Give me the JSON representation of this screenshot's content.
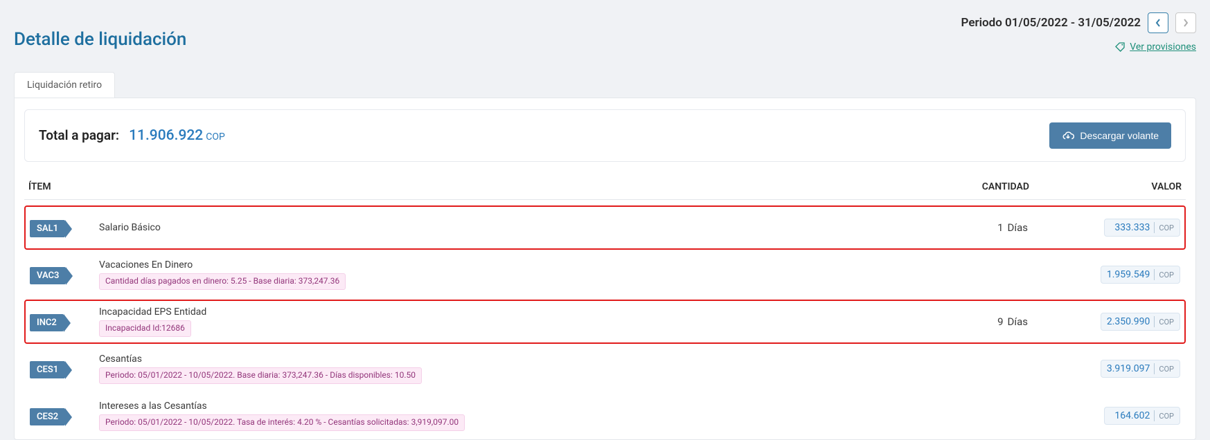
{
  "header": {
    "title": "Detalle de liquidación",
    "period_text": "Periodo 01/05/2022 - 31/05/2022",
    "provisions_link": "Ver provisiones"
  },
  "tabs": {
    "items": [
      {
        "label": "Liquidación retiro"
      }
    ]
  },
  "summary": {
    "total_label": "Total a pagar:",
    "total_value": "11.906.922",
    "total_currency": "COP",
    "download_label": "Descargar volante"
  },
  "table": {
    "columns": {
      "item": "ÍTEM",
      "qty": "CANTIDAD",
      "value": "VALOR"
    },
    "rows": [
      {
        "code": "SAL1",
        "title": "Salario Básico",
        "sub": "",
        "qty_num": "1",
        "qty_unit": "Días",
        "value": "333.333",
        "currency": "COP",
        "highlight": true
      },
      {
        "code": "VAC3",
        "title": "Vacaciones En Dinero",
        "sub": "Cantidad días pagados en dinero: 5.25 - Base diaria: 373,247.36",
        "qty_num": "",
        "qty_unit": "",
        "value": "1.959.549",
        "currency": "COP",
        "highlight": false
      },
      {
        "code": "INC2",
        "title": "Incapacidad EPS Entidad",
        "sub": "Incapacidad Id:12686",
        "qty_num": "9",
        "qty_unit": "Días",
        "value": "2.350.990",
        "currency": "COP",
        "highlight": true
      },
      {
        "code": "CES1",
        "title": "Cesantías",
        "sub": "Periodo: 05/01/2022 - 10/05/2022. Base diaria: 373,247.36 - Días disponibles: 10.50",
        "qty_num": "",
        "qty_unit": "",
        "value": "3.919.097",
        "currency": "COP",
        "highlight": false
      },
      {
        "code": "CES2",
        "title": "Intereses a las Cesantías",
        "sub": "Periodo: 05/01/2022 - 10/05/2022. Tasa de interés: 4.20 % - Cesantías solicitadas: 3,919,097.00",
        "qty_num": "",
        "qty_unit": "",
        "value": "164.602",
        "currency": "COP",
        "highlight": false
      }
    ]
  }
}
